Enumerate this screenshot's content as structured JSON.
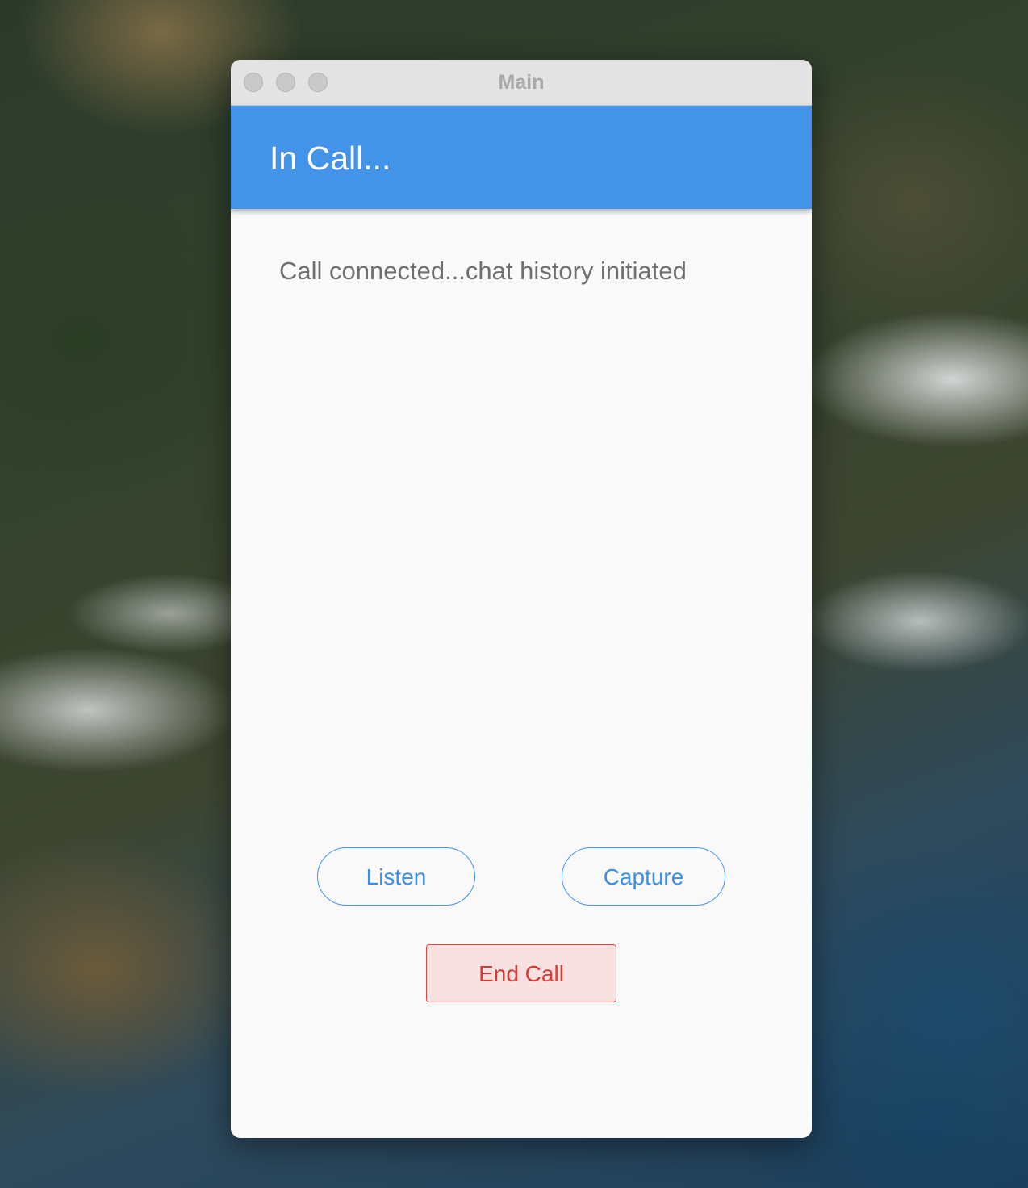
{
  "window": {
    "title": "Main"
  },
  "appbar": {
    "title": "In Call..."
  },
  "content": {
    "status_text": "Call connected...chat history initiated"
  },
  "buttons": {
    "listen_label": "Listen",
    "capture_label": "Capture",
    "end_call_label": "End Call"
  },
  "colors": {
    "appbar": "#4393e9",
    "primary_text": "#3d8ee6",
    "danger": "#d93a30",
    "danger_bg": "#f8e1e1"
  }
}
